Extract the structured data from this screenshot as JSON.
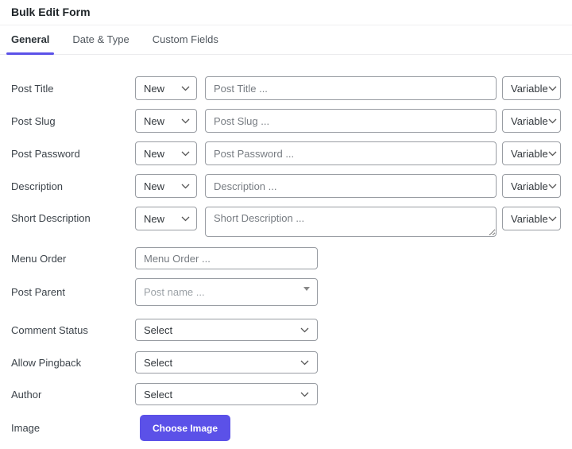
{
  "header": {
    "title": "Bulk Edit Form"
  },
  "tabs": [
    {
      "label": "General",
      "active": true
    },
    {
      "label": "Date & Type",
      "active": false
    },
    {
      "label": "Custom Fields",
      "active": false
    }
  ],
  "colors": {
    "accent": "#5b51e8",
    "border": "#999da3"
  },
  "triple_rows": [
    {
      "label": "Post Title",
      "mode": "New",
      "placeholder": "Post Title ...",
      "variable": "Variable"
    },
    {
      "label": "Post Slug",
      "mode": "New",
      "placeholder": "Post Slug ...",
      "variable": "Variable"
    },
    {
      "label": "Post Password",
      "mode": "New",
      "placeholder": "Post Password ...",
      "variable": "Variable"
    },
    {
      "label": "Description",
      "mode": "New",
      "placeholder": "Description ...",
      "variable": "Variable"
    },
    {
      "label": "Short Description",
      "mode": "New",
      "placeholder": "Short Description ...",
      "variable": "Variable"
    }
  ],
  "fields": {
    "menu_order": {
      "label": "Menu Order",
      "placeholder": "Menu Order ..."
    },
    "post_parent": {
      "label": "Post Parent",
      "placeholder": "Post name ..."
    },
    "comment_status": {
      "label": "Comment Status",
      "value": "Select"
    },
    "allow_pingback": {
      "label": "Allow Pingback",
      "value": "Select"
    },
    "author": {
      "label": "Author",
      "value": "Select"
    },
    "image": {
      "label": "Image",
      "button_label": "Choose Image"
    }
  }
}
